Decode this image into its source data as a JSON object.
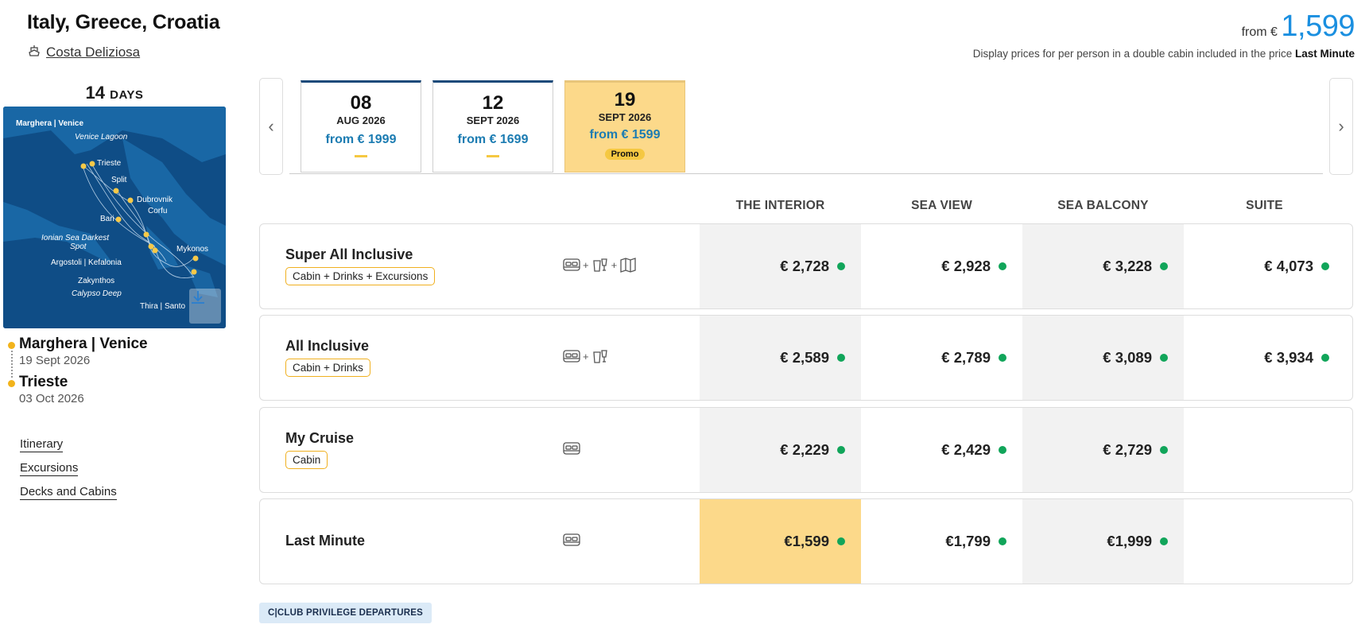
{
  "header": {
    "title": "Italy, Greece, Croatia",
    "ship": "Costa Deliziosa",
    "from_label": "from €",
    "from_price": "1,599",
    "note_prefix": "Display prices for per person in a double cabin included in the price",
    "note_highlight": "Last Minute"
  },
  "duration": {
    "number": "14",
    "unit": "DAYS"
  },
  "map": {
    "labels": [
      "Marghera | Venice",
      "Venice Lagoon",
      "Trieste",
      "Split",
      "Dubrovnik",
      "Corfu",
      "Bari",
      "Ionian Sea Darkest",
      "Spot",
      "Mykonos",
      "Argostoli | Kefalonia",
      "Zakynthos",
      "Calypso Deep",
      "Thira | Santo"
    ]
  },
  "route": {
    "start_port": "Marghera | Venice",
    "start_date": "19 Sept 2026",
    "end_port": "Trieste",
    "end_date": "03 Oct 2026"
  },
  "side_links": [
    "Itinerary",
    "Excursions",
    "Decks and Cabins"
  ],
  "dates": [
    {
      "day": "08",
      "month": "AUG 2026",
      "from": "from € 1999",
      "promo": ""
    },
    {
      "day": "12",
      "month": "SEPT 2026",
      "from": "from € 1699",
      "promo": ""
    },
    {
      "day": "19",
      "month": "SEPT 2026",
      "from": "from € 1599",
      "promo": "Promo"
    }
  ],
  "columns": [
    "THE INTERIOR",
    "SEA VIEW",
    "SEA BALCONY",
    "SUITE"
  ],
  "packages": [
    {
      "name": "Super All Inclusive",
      "badge": "Cabin + Drinks + Excursions",
      "prices": [
        "€ 2,728",
        "€ 2,928",
        "€ 3,228",
        "€ 4,073"
      ]
    },
    {
      "name": "All Inclusive",
      "badge": "Cabin + Drinks",
      "prices": [
        "€ 2,589",
        "€ 2,789",
        "€ 3,089",
        "€ 3,934"
      ]
    },
    {
      "name": "My Cruise",
      "badge": "Cabin",
      "prices": [
        "€ 2,229",
        "€ 2,429",
        "€ 2,729",
        ""
      ]
    },
    {
      "name": "Last Minute",
      "badge": "",
      "prices": [
        "€1,599",
        "€1,799",
        "€1,999",
        ""
      ]
    }
  ],
  "cclub_label": "C|CLUB PRIVILEGE DEPARTURES",
  "colors": {
    "accent_blue": "#1a8fe0",
    "highlight": "#fcd98a",
    "available": "#11a55a",
    "badge_border": "#f0b020",
    "map_sea": "#0f4d86"
  }
}
